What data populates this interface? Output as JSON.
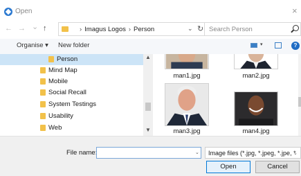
{
  "window": {
    "title": "Open",
    "close_glyph": "×"
  },
  "navigation": {
    "back_glyph": "←",
    "forward_glyph": "→",
    "recent_glyph": "⌄",
    "up_glyph": "↑",
    "breadcrumb": [
      "Imagus Logos",
      "Person"
    ],
    "separator": "›",
    "address_dropdown_glyph": "⌄",
    "refresh_glyph": "↻"
  },
  "search": {
    "placeholder": "Search Person"
  },
  "toolbar": {
    "organise_label": "Organise ▾",
    "new_folder_label": "New folder",
    "view_dropdown_glyph": "▾",
    "help_glyph": "?"
  },
  "tree": {
    "items": [
      {
        "label": "Person",
        "selected": true
      },
      {
        "label": "Mind Map",
        "selected": false
      },
      {
        "label": "Mobile",
        "selected": false
      },
      {
        "label": "Social Recall",
        "selected": false
      },
      {
        "label": "System Testings",
        "selected": false
      },
      {
        "label": "Usability",
        "selected": false
      },
      {
        "label": "Web",
        "selected": false
      }
    ],
    "scroll_up_glyph": "▲",
    "scroll_down_glyph": "▼"
  },
  "files": [
    {
      "name": "man1.jpg",
      "photo_bg": "#c7b59f",
      "tone": "#d8a98a"
    },
    {
      "name": "man2.jpg",
      "photo_bg": "#ffffff",
      "tone": "#d9b49a"
    },
    {
      "name": "man3.jpg",
      "photo_bg": "#e9e9e9",
      "tone": "#e0a288"
    },
    {
      "name": "man4.jpg",
      "photo_bg": "#2c2b2d",
      "tone": "#7a4a30"
    }
  ],
  "footer": {
    "file_name_label": "File name:",
    "file_name_value": "",
    "file_name_dropdown_glyph": "⌄",
    "filter_label": "Image files (*.jpg, *.jpeg, *.jpe, *",
    "filter_dropdown_glyph": "⌄",
    "open_label": "Open",
    "cancel_label": "Cancel"
  },
  "colors": {
    "selected_row": "#cce4f7",
    "accent": "#0078d7",
    "folder": "#f2c14a"
  }
}
